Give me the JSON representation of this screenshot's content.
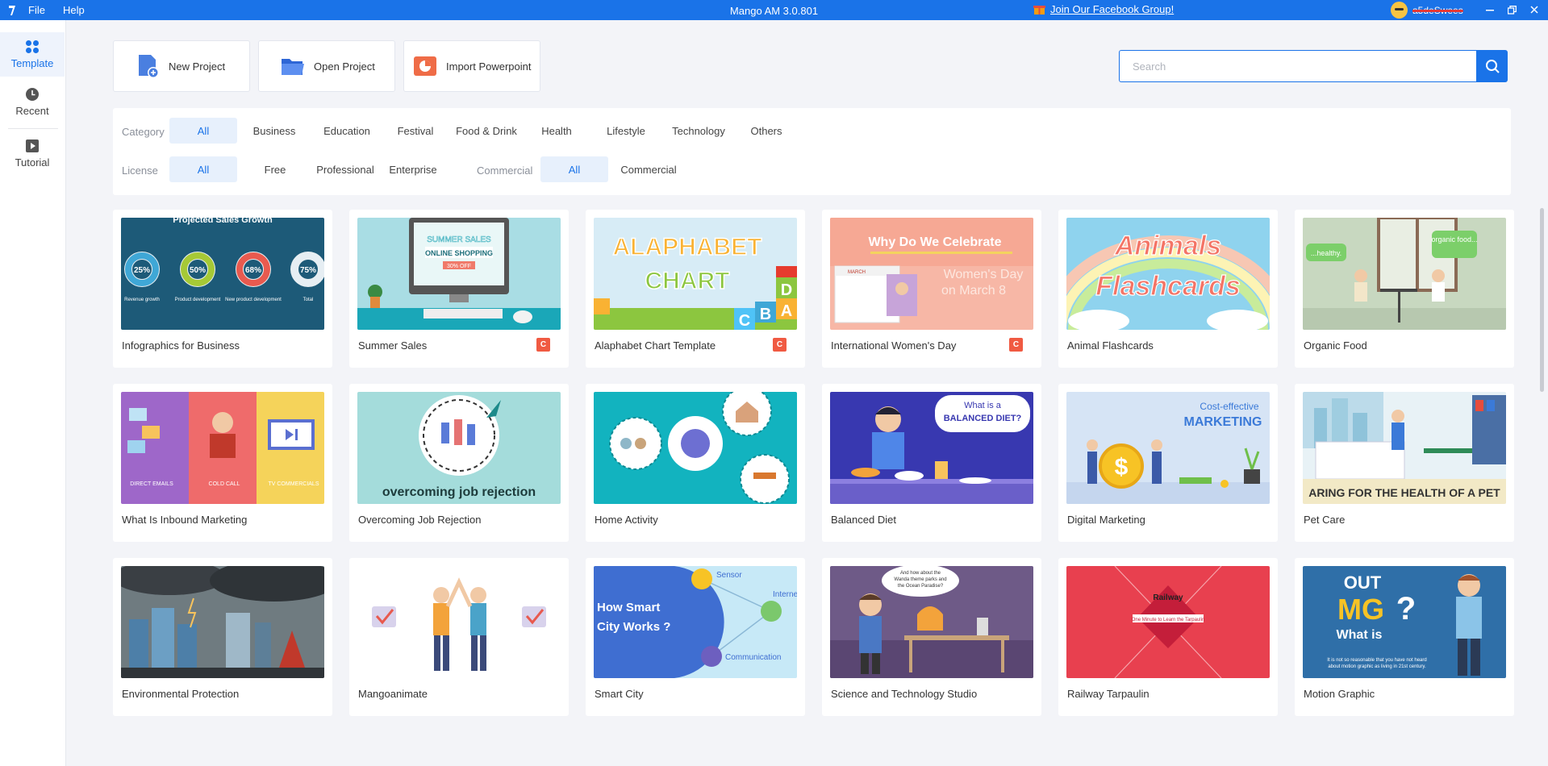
{
  "titlebar": {
    "menus": [
      "File",
      "Help"
    ],
    "app_title": "Mango AM 3.0.801",
    "facebook_link": "Join Our Facebook Group!",
    "username": "a5deSwees"
  },
  "sidebar": {
    "items": [
      {
        "label": "Template",
        "icon": "grid-icon"
      },
      {
        "label": "Recent",
        "icon": "clock-icon"
      },
      {
        "label": "Tutorial",
        "icon": "play-icon"
      }
    ]
  },
  "toolbar": {
    "new_project": "New Project",
    "open_project": "Open Project",
    "import_powerpoint": "Import Powerpoint"
  },
  "search": {
    "placeholder": "Search"
  },
  "filters": {
    "category_label": "Category",
    "categories": [
      "All",
      "Business",
      "Education",
      "Festival",
      "Food & Drink",
      "Health",
      "Lifestyle",
      "Technology",
      "Others"
    ],
    "license_label": "License",
    "licenses": [
      "All",
      "Free",
      "Professional",
      "Enterprise"
    ],
    "commercial_label": "Commercial",
    "commercial_options": [
      "All",
      "Commercial"
    ]
  },
  "templates": [
    {
      "title": "Infographics for Business",
      "badge": ""
    },
    {
      "title": "Summer Sales",
      "badge": "C"
    },
    {
      "title": "Alaphabet Chart Template",
      "badge": "C"
    },
    {
      "title": "International Women's Day",
      "badge": "C"
    },
    {
      "title": "Animal Flashcards",
      "badge": ""
    },
    {
      "title": "Organic Food",
      "badge": ""
    },
    {
      "title": "What Is Inbound Marketing",
      "badge": ""
    },
    {
      "title": "Overcoming Job Rejection",
      "badge": ""
    },
    {
      "title": "Home Activity",
      "badge": ""
    },
    {
      "title": "Balanced Diet",
      "badge": ""
    },
    {
      "title": "Digital Marketing",
      "badge": ""
    },
    {
      "title": "Pet Care",
      "badge": ""
    },
    {
      "title": "Environmental Protection",
      "badge": ""
    },
    {
      "title": "Mangoanimate",
      "badge": ""
    },
    {
      "title": "Smart City",
      "badge": ""
    },
    {
      "title": "Science and Technology Studio",
      "badge": ""
    },
    {
      "title": "Railway Tarpaulin",
      "badge": ""
    },
    {
      "title": "Motion Graphic",
      "badge": ""
    }
  ],
  "thumb_text": {
    "infographic": {
      "heading": "Projected Sales Growth",
      "p1": "25%",
      "p2": "50%",
      "p3": "68%",
      "p4": "75%",
      "l1": "Revenue growth",
      "l2": "Product development",
      "l3": "New product development",
      "l4": "Total"
    },
    "summer": {
      "line1": "SUMMER SALES",
      "line2": "ONLINE SHOPPING",
      "line3": "30% OFF"
    },
    "alphabet": {
      "line1": "ALAPHABET",
      "line2": "CHART"
    },
    "womens": {
      "line1": "Why Do We Celebrate",
      "line2": "Women's Day",
      "line3": "on March 8",
      "line4": "MARCH"
    },
    "animals": {
      "line1": "Animals",
      "line2": "Flashcards"
    },
    "organic": {
      "b1": "...healthy.",
      "b2": "organic food..."
    },
    "inbound": {
      "c1": "DIRECT EMAILS",
      "c2": "COLD CALL",
      "c3": "TV COMMERCIALS"
    },
    "job": {
      "line1": "overcoming job rejection"
    },
    "diet": {
      "line1": "What is a",
      "line2": "BALANCED DIET?"
    },
    "digital": {
      "line1": "Cost-effective",
      "line2": "MARKETING"
    },
    "pet": {
      "line1": "ARING FOR THE HEALTH OF A PET"
    },
    "smartcity": {
      "line1": "How Smart",
      "line2": "City Works ?",
      "s1": "Sensor",
      "s2": "Interne",
      "s3": "Communication"
    },
    "science": {
      "bubble1": "And how about the",
      "bubble2": "Wanda theme parks and",
      "bubble3": "the Ocean Paradise?"
    },
    "railway": {
      "line1": "Railway",
      "line2": "One Minute to Learn the Tarpaulin"
    },
    "motion": {
      "line1": "OUT",
      "line2": "MG",
      "line3": "What is",
      "line4": "It is not so reasonable that you have not heard",
      "line5": "about motion graphic as living in 21st century."
    }
  },
  "colors": {
    "accent": "#1a73e8",
    "badge": "#f05a42",
    "chip_active_bg": "#e7f0fc"
  }
}
